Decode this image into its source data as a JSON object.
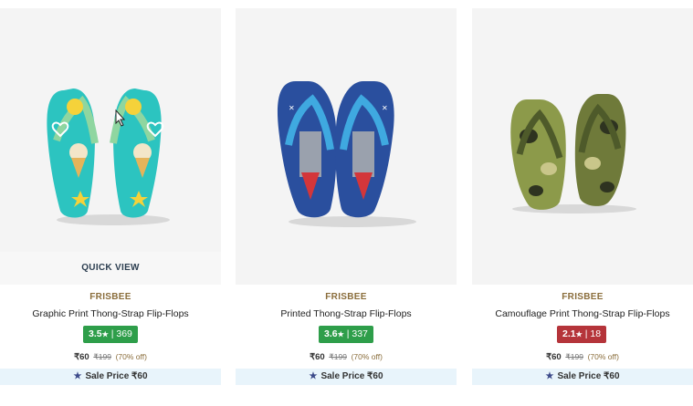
{
  "products": [
    {
      "brand": "FRISBEE",
      "name": "Graphic Print Thong-Strap Flip-Flops",
      "rating": "3.5",
      "rating_star": "★",
      "rating_sep": "|",
      "reviews": "369",
      "rating_color": "#2e9e4a",
      "price": "₹60",
      "mrp": "₹199",
      "discount": "(70% off)",
      "sale_icon": "★",
      "sale_label": "Sale Price ₹60",
      "quick_view": "QUICK VIEW"
    },
    {
      "brand": "FRISBEE",
      "name": "Printed Thong-Strap Flip-Flops",
      "rating": "3.6",
      "rating_star": "★",
      "rating_sep": "|",
      "reviews": "337",
      "rating_color": "#2e9e4a",
      "price": "₹60",
      "mrp": "₹199",
      "discount": "(70% off)",
      "sale_icon": "★",
      "sale_label": "Sale Price ₹60"
    },
    {
      "brand": "FRISBEE",
      "name": "Camouflage Print Thong-Strap Flip-Flops",
      "rating": "2.1",
      "rating_star": "★",
      "rating_sep": "|",
      "reviews": "18",
      "rating_color": "#b5343a",
      "price": "₹60",
      "mrp": "₹199",
      "discount": "(70% off)",
      "sale_icon": "★",
      "sale_label": "Sale Price ₹60"
    }
  ]
}
